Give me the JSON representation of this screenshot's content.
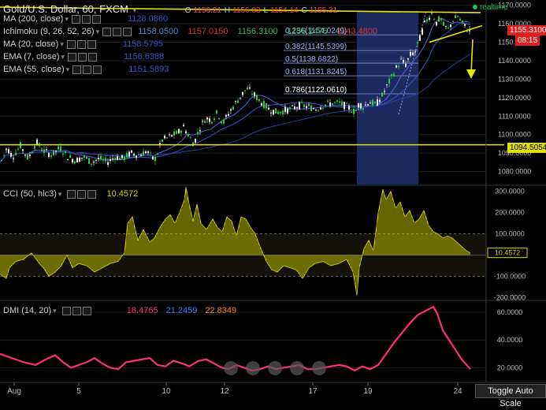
{
  "header": {
    "title": "Gold/U.S. Dollar, 60, FXCM",
    "ohlc": [
      {
        "k": "O",
        "v": "1156.21"
      },
      {
        "k": "H",
        "v": "1156.83"
      },
      {
        "k": "L",
        "v": "1154.14"
      },
      {
        "k": "C",
        "v": "1155.31"
      }
    ],
    "realtime": "realtime"
  },
  "indicators": [
    {
      "label": "MA (200, close)",
      "values": [
        "1128.0860"
      ],
      "colors": [
        "#3d52c9"
      ]
    },
    {
      "label": "Ichimoku (9, 26, 52, 26)",
      "values": [
        "1158.0500",
        "1157.0150",
        "1156.3100",
        "1156.2475",
        "1143.4800"
      ],
      "colors": [
        "#3d8fd8",
        "#e03030",
        "#2fbf4f",
        "#2fbf4f",
        "#e03030"
      ]
    },
    {
      "label": "MA (20, close)",
      "values": [
        "1158.5795"
      ],
      "colors": [
        "#3d52c9"
      ]
    },
    {
      "label": "EMA (7, close)",
      "values": [
        "1156.6388"
      ],
      "colors": [
        "#3d52c9"
      ]
    },
    {
      "label": "EMA (55, close)",
      "values": [
        "1151.5893"
      ],
      "colors": [
        "#3d52c9"
      ]
    }
  ],
  "price_labels": {
    "last": "1155.3100",
    "countdown": "08:15",
    "support": "1094.5054"
  },
  "fib_labels": [
    "0.236(1154.0249)",
    "0.382(1145.5399)",
    "0.5(1138.6822)",
    "0.618(1131.8245)",
    "0.786(1122.0610)"
  ],
  "cci_header": {
    "label": "CCI (50, hlc3)",
    "value": "10.4572",
    "color": "#d8d800"
  },
  "dmi_header": {
    "label": "DMI (14, 20)",
    "values": [
      "18.4765",
      "21.2459",
      "22.8349"
    ],
    "colors": [
      "#ff2f7a",
      "#4a78ff",
      "#ff8a1f"
    ]
  },
  "toggle_label": "Toggle Auto Scale",
  "chart_data": [
    {
      "type": "candlestick",
      "title": "Gold/U.S. Dollar, 60, FXCM",
      "x_ticks": [
        "Aug",
        "5",
        "10",
        "12",
        "17",
        "19",
        "24"
      ],
      "y_ticks": [
        1080,
        1090,
        1100,
        1110,
        1120,
        1130,
        1140,
        1150,
        1160,
        1170
      ],
      "ylim": [
        1073,
        1172
      ],
      "path": [
        [
          0,
          1085
        ],
        [
          8,
          1093
        ],
        [
          15,
          1088
        ],
        [
          25,
          1094
        ],
        [
          35,
          1087
        ],
        [
          45,
          1096
        ],
        [
          55,
          1091
        ],
        [
          65,
          1089
        ],
        [
          75,
          1093
        ],
        [
          85,
          1088
        ],
        [
          95,
          1086
        ],
        [
          105,
          1088
        ],
        [
          115,
          1085
        ],
        [
          125,
          1087
        ],
        [
          135,
          1085
        ],
        [
          145,
          1088
        ],
        [
          155,
          1087
        ],
        [
          165,
          1090
        ],
        [
          175,
          1089
        ],
        [
          185,
          1091
        ],
        [
          195,
          1086
        ],
        [
          205,
          1097
        ],
        [
          215,
          1099
        ],
        [
          225,
          1101
        ],
        [
          232,
          1104
        ],
        [
          238,
          1100
        ],
        [
          245,
          1095
        ],
        [
          252,
          1103
        ],
        [
          260,
          1109
        ],
        [
          268,
          1108
        ],
        [
          275,
          1112
        ],
        [
          282,
          1106
        ],
        [
          290,
          1112
        ],
        [
          298,
          1117
        ],
        [
          305,
          1121
        ],
        [
          312,
          1125
        ],
        [
          318,
          1123
        ],
        [
          325,
          1120
        ],
        [
          332,
          1117
        ],
        [
          340,
          1114
        ],
        [
          350,
          1112
        ],
        [
          360,
          1113
        ],
        [
          370,
          1114
        ],
        [
          380,
          1116
        ],
        [
          390,
          1115
        ],
        [
          400,
          1114
        ],
        [
          410,
          1116
        ],
        [
          420,
          1117
        ],
        [
          430,
          1117
        ],
        [
          440,
          1115
        ],
        [
          450,
          1112
        ],
        [
          455,
          1117
        ],
        [
          460,
          1115
        ],
        [
          468,
          1118
        ],
        [
          476,
          1116
        ],
        [
          484,
          1121
        ],
        [
          490,
          1126
        ],
        [
          496,
          1131
        ],
        [
          502,
          1136
        ],
        [
          508,
          1140
        ],
        [
          514,
          1138
        ],
        [
          520,
          1143
        ],
        [
          526,
          1145
        ],
        [
          532,
          1152
        ],
        [
          538,
          1160
        ],
        [
          544,
          1164
        ],
        [
          548,
          1167
        ],
        [
          552,
          1160
        ],
        [
          558,
          1163
        ],
        [
          562,
          1159
        ],
        [
          568,
          1157
        ],
        [
          574,
          1162
        ],
        [
          580,
          1164
        ],
        [
          586,
          1160
        ],
        [
          592,
          1157
        ],
        [
          597,
          1155.31
        ]
      ],
      "trend_lines": [
        {
          "name": "resistance",
          "from": [
            0,
            1169
          ],
          "to": [
            610,
            1166
          ]
        },
        {
          "name": "support",
          "from": [
            0,
            1094.5
          ],
          "to": [
            640,
            1094.5
          ]
        },
        {
          "name": "wedge-lower",
          "from": [
            545,
            1150
          ],
          "to": [
            612,
            1159
          ]
        }
      ],
      "fib_retracement": {
        "high": 1167,
        "low": 1111,
        "levels": [
          1154.0249,
          1145.5399,
          1138.6822,
          1131.8245,
          1122.061
        ]
      }
    },
    {
      "type": "line",
      "title": "CCI (50, hlc3)",
      "y_ticks": [
        -200,
        -100,
        0,
        100,
        200,
        300
      ],
      "ylim": [
        -210,
        325
      ],
      "bands": [
        -100,
        100
      ],
      "path": [
        [
          0,
          -90
        ],
        [
          8,
          -110
        ],
        [
          12,
          -60
        ],
        [
          20,
          -30
        ],
        [
          30,
          -20
        ],
        [
          40,
          10
        ],
        [
          50,
          -40
        ],
        [
          55,
          -60
        ],
        [
          62,
          -100
        ],
        [
          70,
          -80
        ],
        [
          78,
          -50
        ],
        [
          85,
          0
        ],
        [
          92,
          -60
        ],
        [
          100,
          -40
        ],
        [
          110,
          -50
        ],
        [
          120,
          -80
        ],
        [
          130,
          -60
        ],
        [
          140,
          -40
        ],
        [
          150,
          -30
        ],
        [
          158,
          10
        ],
        [
          162,
          150
        ],
        [
          168,
          180
        ],
        [
          175,
          70
        ],
        [
          182,
          120
        ],
        [
          190,
          60
        ],
        [
          196,
          80
        ],
        [
          203,
          130
        ],
        [
          210,
          170
        ],
        [
          216,
          190
        ],
        [
          222,
          150
        ],
        [
          228,
          200
        ],
        [
          234,
          260
        ],
        [
          236,
          320
        ],
        [
          240,
          240
        ],
        [
          245,
          160
        ],
        [
          250,
          240
        ],
        [
          255,
          150
        ],
        [
          262,
          120
        ],
        [
          270,
          170
        ],
        [
          276,
          130
        ],
        [
          282,
          110
        ],
        [
          288,
          180
        ],
        [
          294,
          160
        ],
        [
          300,
          90
        ],
        [
          306,
          180
        ],
        [
          312,
          170
        ],
        [
          318,
          130
        ],
        [
          324,
          100
        ],
        [
          330,
          40
        ],
        [
          338,
          -30
        ],
        [
          345,
          -70
        ],
        [
          352,
          -80
        ],
        [
          360,
          -50
        ],
        [
          368,
          -60
        ],
        [
          376,
          -70
        ],
        [
          384,
          -110
        ],
        [
          392,
          -60
        ],
        [
          400,
          -40
        ],
        [
          410,
          -30
        ],
        [
          420,
          -50
        ],
        [
          430,
          -40
        ],
        [
          440,
          -20
        ],
        [
          448,
          -80
        ],
        [
          453,
          -190
        ],
        [
          456,
          -60
        ],
        [
          462,
          30
        ],
        [
          468,
          70
        ],
        [
          474,
          20
        ],
        [
          480,
          200
        ],
        [
          486,
          310
        ],
        [
          490,
          260
        ],
        [
          496,
          300
        ],
        [
          502,
          220
        ],
        [
          508,
          250
        ],
        [
          514,
          180
        ],
        [
          520,
          210
        ],
        [
          526,
          150
        ],
        [
          532,
          170
        ],
        [
          538,
          210
        ],
        [
          544,
          140
        ],
        [
          550,
          110
        ],
        [
          556,
          100
        ],
        [
          562,
          80
        ],
        [
          568,
          90
        ],
        [
          574,
          80
        ],
        [
          580,
          60
        ],
        [
          586,
          40
        ],
        [
          592,
          20
        ],
        [
          597,
          10.4572
        ]
      ]
    },
    {
      "type": "line",
      "title": "DMI (14, 20)",
      "y_ticks": [
        20,
        40,
        60
      ],
      "ylim": [
        10,
        68
      ],
      "series": [
        {
          "name": "18.4765",
          "color": "#ff2f7a",
          "values": [
            [
              0,
              30
            ],
            [
              15,
              27
            ],
            [
              30,
              24
            ],
            [
              45,
              22
            ],
            [
              58,
              26
            ],
            [
              70,
              29
            ],
            [
              80,
              24
            ],
            [
              90,
              20
            ],
            [
              100,
              22
            ],
            [
              110,
              24
            ],
            [
              120,
              27
            ],
            [
              130,
              23
            ],
            [
              140,
              20
            ],
            [
              150,
              19
            ],
            [
              160,
              24
            ],
            [
              170,
              25
            ],
            [
              180,
              26
            ],
            [
              190,
              27
            ],
            [
              200,
              22
            ],
            [
              210,
              21
            ],
            [
              220,
              25
            ],
            [
              232,
              23
            ],
            [
              240,
              21
            ],
            [
              252,
              25
            ],
            [
              262,
              26
            ],
            [
              272,
              23
            ],
            [
              282,
              20
            ],
            [
              290,
              19
            ],
            [
              300,
              22
            ],
            [
              310,
              20
            ],
            [
              320,
              18
            ],
            [
              330,
              19
            ],
            [
              340,
              21
            ],
            [
              350,
              19
            ],
            [
              360,
              20
            ],
            [
              370,
              21
            ],
            [
              380,
              22
            ],
            [
              390,
              19
            ],
            [
              400,
              19
            ],
            [
              410,
              20
            ],
            [
              420,
              21
            ],
            [
              430,
              22
            ],
            [
              440,
              21
            ],
            [
              450,
              18
            ],
            [
              460,
              21
            ],
            [
              470,
              19
            ],
            [
              480,
              22
            ],
            [
              490,
              30
            ],
            [
              500,
              38
            ],
            [
              510,
              45
            ],
            [
              520,
              52
            ],
            [
              530,
              58
            ],
            [
              540,
              61
            ],
            [
              550,
              64
            ],
            [
              555,
              59
            ],
            [
              562,
              47
            ],
            [
              570,
              40
            ],
            [
              578,
              33
            ],
            [
              586,
              26
            ],
            [
              597,
              19
            ]
          ]
        }
      ]
    }
  ]
}
